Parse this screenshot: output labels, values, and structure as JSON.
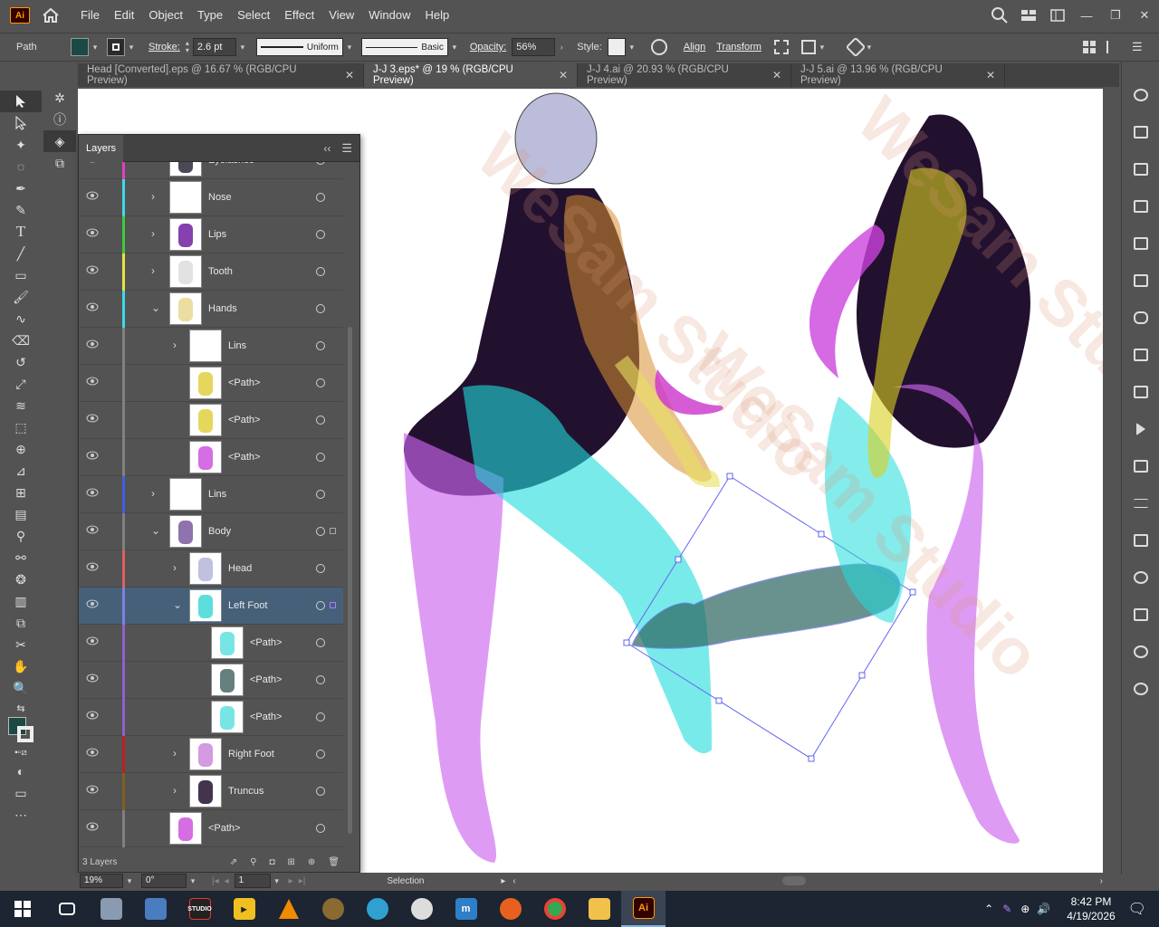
{
  "menubar": {
    "logo": "Ai",
    "items": [
      "File",
      "Edit",
      "Object",
      "Type",
      "Select",
      "Effect",
      "View",
      "Window",
      "Help"
    ]
  },
  "control": {
    "selection_type": "Path",
    "stroke_label": "Stroke:",
    "stroke_weight": "2.6 pt",
    "profile_uniform": "Uniform",
    "brush_basic": "Basic",
    "opacity_label": "Opacity:",
    "opacity_value": "56%",
    "style_label": "Style:",
    "align_label": "Align",
    "transform_label": "Transform",
    "fill_color": "#1b4a44"
  },
  "tabs": [
    {
      "label": "Head [Converted].eps @ 16.67 % (RGB/CPU Preview)",
      "active": false
    },
    {
      "label": "J-J 3.eps* @ 19 % (RGB/CPU Preview)",
      "active": true
    },
    {
      "label": "J-J 4.ai @ 20.93 % (RGB/CPU Preview)",
      "active": false
    },
    {
      "label": "J-J 5.ai @ 13.96 % (RGB/CPU Preview)",
      "active": false
    }
  ],
  "layers": {
    "tab_label": "Layers",
    "footer_count": "3 Layers",
    "rows": [
      {
        "name": "Eyelashes",
        "indent": 1,
        "color": "#e040c0",
        "chev": ">"
      },
      {
        "name": "Nose",
        "indent": 1,
        "color": "#40d8e8",
        "chev": ">"
      },
      {
        "name": "Lips",
        "indent": 1,
        "color": "#40c840",
        "chev": ">"
      },
      {
        "name": "Tooth",
        "indent": 1,
        "color": "#e8e040",
        "chev": ">"
      },
      {
        "name": "Hands",
        "indent": 1,
        "color": "#40d8e8",
        "chev": "v"
      },
      {
        "name": "Lins",
        "indent": 2,
        "color": "#808080",
        "chev": ">"
      },
      {
        "name": "<Path>",
        "indent": 2,
        "color": "#808080",
        "chev": ""
      },
      {
        "name": "<Path>",
        "indent": 2,
        "color": "#808080",
        "chev": ""
      },
      {
        "name": "<Path>",
        "indent": 2,
        "color": "#808080",
        "chev": ""
      },
      {
        "name": "Lins",
        "indent": 1,
        "color": "#4060e0",
        "chev": ">"
      },
      {
        "name": "Body",
        "indent": 1,
        "color": "#808080",
        "chev": "v"
      },
      {
        "name": "Head",
        "indent": 2,
        "color": "#e06060",
        "chev": ">"
      },
      {
        "name": "Left Foot",
        "indent": 2,
        "color": "#8080e0",
        "chev": "v",
        "selected": true
      },
      {
        "name": "<Path>",
        "indent": 3,
        "color": "#9060d0",
        "chev": ""
      },
      {
        "name": "<Path>",
        "indent": 3,
        "color": "#9060d0",
        "chev": ""
      },
      {
        "name": "<Path>",
        "indent": 3,
        "color": "#9060d0",
        "chev": ""
      },
      {
        "name": "Right Foot",
        "indent": 2,
        "color": "#c02020",
        "chev": ">"
      },
      {
        "name": "Truncus",
        "indent": 2,
        "color": "#806020",
        "chev": ">"
      },
      {
        "name": "<Path>",
        "indent": 1,
        "color": "#808080",
        "chev": ""
      }
    ]
  },
  "status": {
    "zoom": "19%",
    "rotation": "0°",
    "artboard": "1",
    "tool": "Selection"
  },
  "watermark": "WeSam Studio",
  "taskbar": {
    "time": "8:42 PM",
    "date": "4/19/2026",
    "app_ai": "Ai"
  }
}
